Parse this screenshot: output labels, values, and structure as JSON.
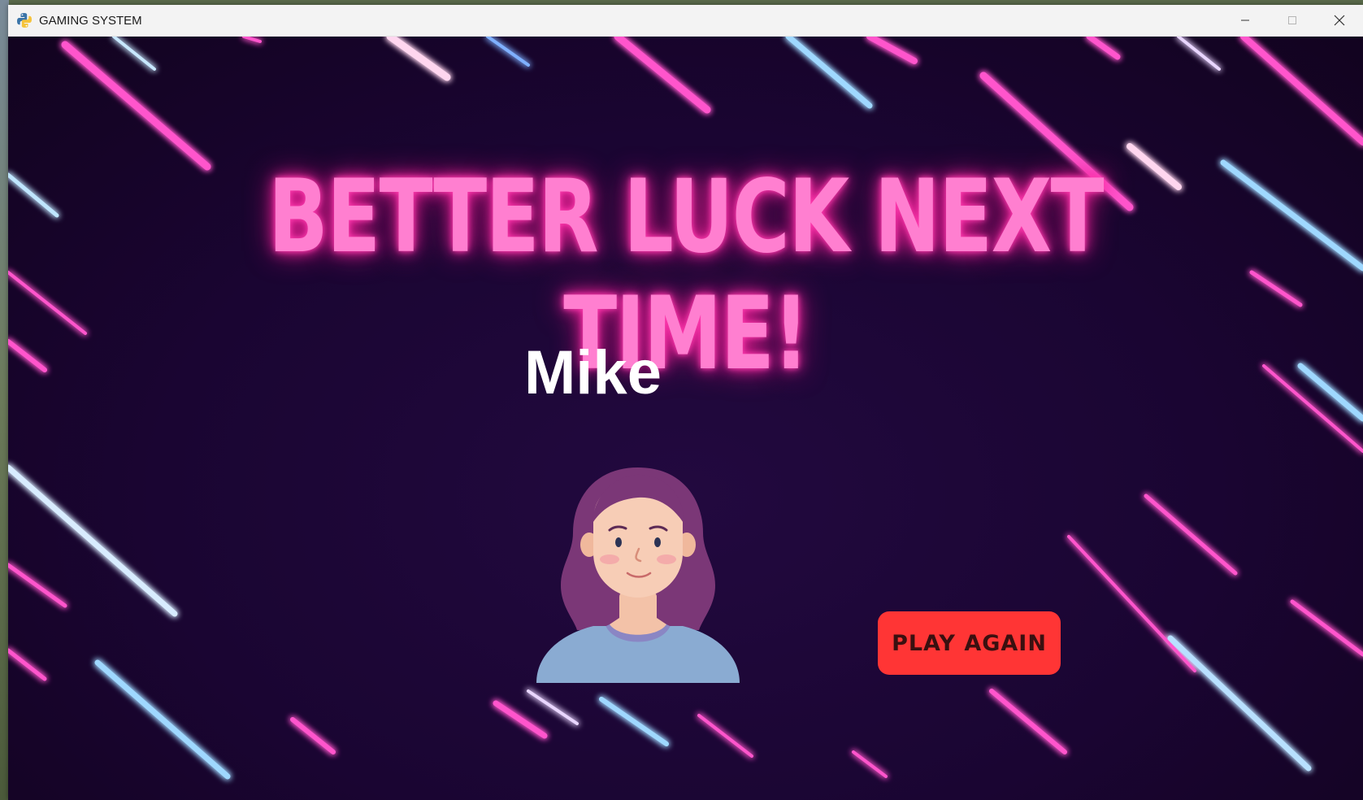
{
  "window": {
    "title": "GAMING SYSTEM",
    "app_icon": "python-icon",
    "controls": [
      "minimize-icon",
      "maximize-icon",
      "close-icon"
    ]
  },
  "game": {
    "headline": "BETTER LUCK NEXT TIME!",
    "player_name": "Mike",
    "avatar": "player-avatar-icon",
    "play_again_label": "PLAY AGAIN"
  },
  "colors": {
    "background": "#1a0532",
    "headline_glow": "#ff7fd0",
    "button": "#ff3535",
    "streak_pink": "#ff4fc8",
    "streak_blue": "#9fd8ff"
  }
}
